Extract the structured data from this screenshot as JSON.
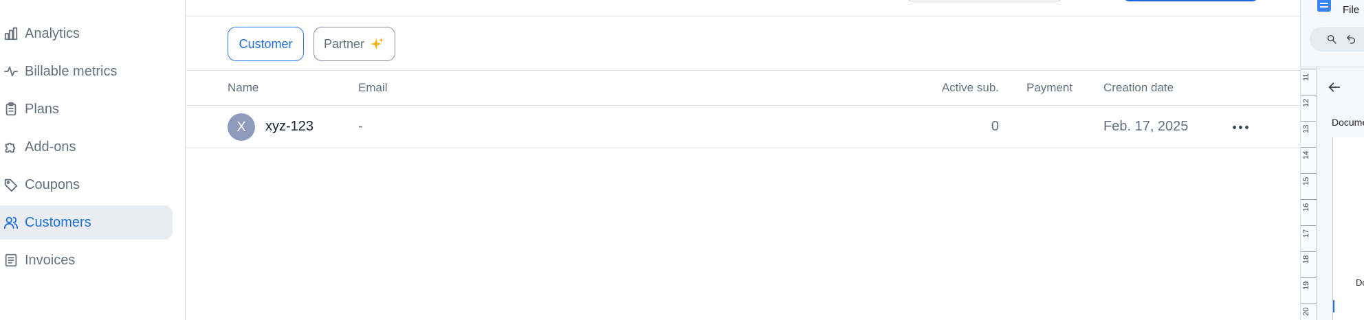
{
  "sidebar": {
    "items": [
      {
        "label": "Analytics",
        "icon": "bar-chart-icon",
        "active": false
      },
      {
        "label": "Billable metrics",
        "icon": "pulse-icon",
        "active": false
      },
      {
        "label": "Plans",
        "icon": "clipboard-icon",
        "active": false
      },
      {
        "label": "Add-ons",
        "icon": "puzzle-icon",
        "active": false
      },
      {
        "label": "Coupons",
        "icon": "tag-icon",
        "active": false
      },
      {
        "label": "Customers",
        "icon": "users-icon",
        "active": true
      },
      {
        "label": "Invoices",
        "icon": "document-icon",
        "active": false
      }
    ]
  },
  "filters": {
    "customer_label": "Customer",
    "partner_label": "Partner",
    "selected": "Customer"
  },
  "table": {
    "columns": {
      "name": "Name",
      "email": "Email",
      "active_sub": "Active sub.",
      "payment": "Payment",
      "creation_date": "Creation date"
    },
    "rows": [
      {
        "avatar_initial": "X",
        "name": "xyz-123",
        "email": "-",
        "active_sub": "0",
        "payment": "",
        "creation_date": "Feb. 17, 2025"
      }
    ]
  },
  "side_panel": {
    "menu_file": "File",
    "tab_label": "Docume",
    "page_text": "Do",
    "ruler_numbers": [
      "11",
      "12",
      "13",
      "14",
      "15",
      "16",
      "17",
      "18",
      "19",
      "20"
    ]
  },
  "colors": {
    "accent": "#1f6fd6",
    "active_bg": "#e9ecf1",
    "muted_text": "#66707d",
    "avatar_bg": "#8e9bbd",
    "sparkle": "#f5b31a"
  }
}
